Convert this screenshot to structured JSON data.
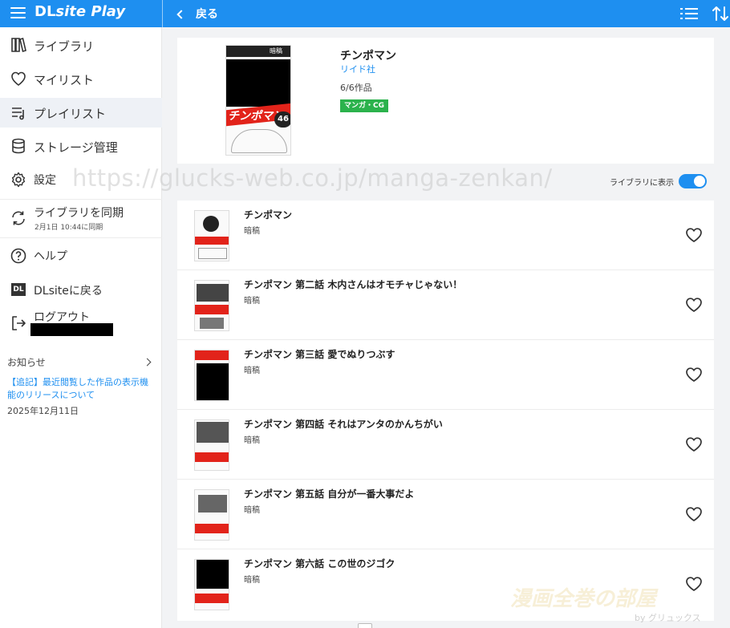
{
  "app": {
    "logo_prefix": "DL",
    "logo_suffix": "site Play",
    "back_label": "戻る",
    "accent_color": "#1e8ff0"
  },
  "sidebar": {
    "items": [
      {
        "label": "ライブラリ",
        "icon": "library-icon"
      },
      {
        "label": "マイリスト",
        "icon": "heart-icon"
      },
      {
        "label": "プレイリスト",
        "icon": "playlist-icon"
      },
      {
        "label": "ストレージ管理",
        "icon": "storage-icon"
      },
      {
        "label": "設定",
        "icon": "gear-icon"
      },
      {
        "label": "ライブラリを同期",
        "sub": "2月1日 10:44に同期",
        "icon": "sync-icon"
      },
      {
        "label": "ヘルプ",
        "icon": "help-icon"
      },
      {
        "label": "DLsiteに戻る",
        "icon": "dl-icon"
      },
      {
        "label": "ログアウト",
        "icon": "logout-icon"
      }
    ],
    "news": {
      "heading": "お知らせ",
      "link": "【追記】最近閲覧した作品の表示機能のリリースについて",
      "date": "2025年12月11日"
    }
  },
  "series": {
    "title": "チンポマン",
    "author": "リイド社",
    "count": "6/6作品",
    "tag": "マンガ・CG",
    "cover_label": "暗稿",
    "cover_volume": "46"
  },
  "watermark": "https://glucks-web.co.jp/manga-zenkan/",
  "library_toggle": {
    "label": "ライブラリに表示",
    "on": true
  },
  "works": [
    {
      "title": "チンポマン",
      "sub": "暗稿"
    },
    {
      "title": "チンポマン 第二話 木内さんはオモチャじゃない！",
      "sub": "暗稿"
    },
    {
      "title": "チンポマン 第三話 愛でぬりつぶす",
      "sub": "暗稿"
    },
    {
      "title": "チンポマン 第四話 それはアンタのかんちがい",
      "sub": "暗稿"
    },
    {
      "title": "チンポマン 第五話 自分が一番大事だよ",
      "sub": "暗稿"
    },
    {
      "title": "チンポマン 第六話 この世のジゴク",
      "sub": "暗稿"
    }
  ],
  "corner_watermark": {
    "main": "漫画全巻の部屋",
    "by": "by グリュックス"
  }
}
